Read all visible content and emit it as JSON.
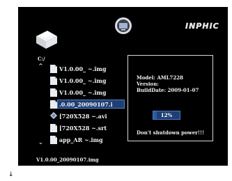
{
  "header": {
    "brand": "INPHIC",
    "top_icon": "tv-icon",
    "folder_icon": "folder-icon"
  },
  "browser": {
    "path": "C:/",
    "items": [
      {
        "label": "V1.0.00_ ~.img",
        "icon": "document-icon",
        "selected": false
      },
      {
        "label": "V1.0.00_ ~.img",
        "icon": "document-icon",
        "selected": false
      },
      {
        "label": "V1.0.00_ ~.img",
        "icon": "document-icon",
        "selected": false
      },
      {
        "label": ".0.00_20090107.i",
        "icon": "document-icon",
        "selected": true
      },
      {
        "label": "[720X528 ~.avi",
        "icon": "video-icon",
        "selected": false
      },
      {
        "label": "[720X528 ~.srt",
        "icon": "document-icon",
        "selected": false
      },
      {
        "label": "app_AR ~.img",
        "icon": "document-icon",
        "selected": false
      }
    ],
    "status": "V1.0.00_20090107.img"
  },
  "info": {
    "model": "Model: AML7228",
    "version": "Version:",
    "build_date": "BuildDate: 2009-01-07",
    "progress_text": "12%",
    "progress_value": 0.12,
    "warning": "Don't shutdown power!!!"
  },
  "colors": {
    "background": "#000000",
    "highlight": "#1d3f73",
    "highlight_border": "#5d82c0",
    "text": "#f1f2f4"
  }
}
